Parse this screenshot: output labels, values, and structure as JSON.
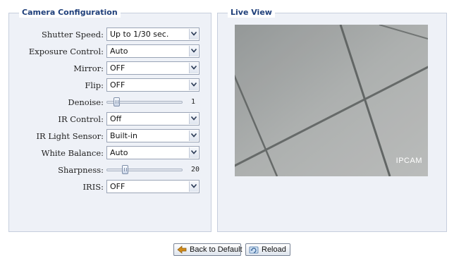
{
  "config": {
    "title": "Camera Configuration",
    "fields": [
      {
        "id": "shutter",
        "label": "Shutter Speed:",
        "type": "select",
        "value": "Up to 1/30 sec."
      },
      {
        "id": "exposure",
        "label": "Exposure Control:",
        "type": "select",
        "value": "Auto"
      },
      {
        "id": "mirror",
        "label": "Mirror:",
        "type": "select",
        "value": "OFF"
      },
      {
        "id": "flip",
        "label": "Flip:",
        "type": "select",
        "value": "OFF"
      },
      {
        "id": "denoise",
        "label": "Denoise:",
        "type": "slider",
        "value": "1",
        "level": 0.1
      },
      {
        "id": "ir-control",
        "label": "IR Control:",
        "type": "select",
        "value": "Off"
      },
      {
        "id": "ir-sensor",
        "label": "IR Light Sensor:",
        "type": "select",
        "value": "Built-in"
      },
      {
        "id": "white-balance",
        "label": "White Balance:",
        "type": "select",
        "value": "Auto"
      },
      {
        "id": "sharpness",
        "label": "Sharpness:",
        "type": "slider",
        "value": "20",
        "level": 0.22
      },
      {
        "id": "iris",
        "label": "IRIS:",
        "type": "select",
        "value": "OFF"
      }
    ]
  },
  "live": {
    "title": "Live View",
    "overlay": "IPCAM"
  },
  "buttons": {
    "default_label": "Back to Default",
    "reload_label": "Reload"
  },
  "icons": {
    "dropdown": "chevron-down-icon",
    "default": "back-arrow-icon",
    "reload": "reload-icon"
  },
  "colors": {
    "legend": "#1f3f7a",
    "panel_bg": "#eef1f7",
    "panel_border": "#c6cedd"
  }
}
